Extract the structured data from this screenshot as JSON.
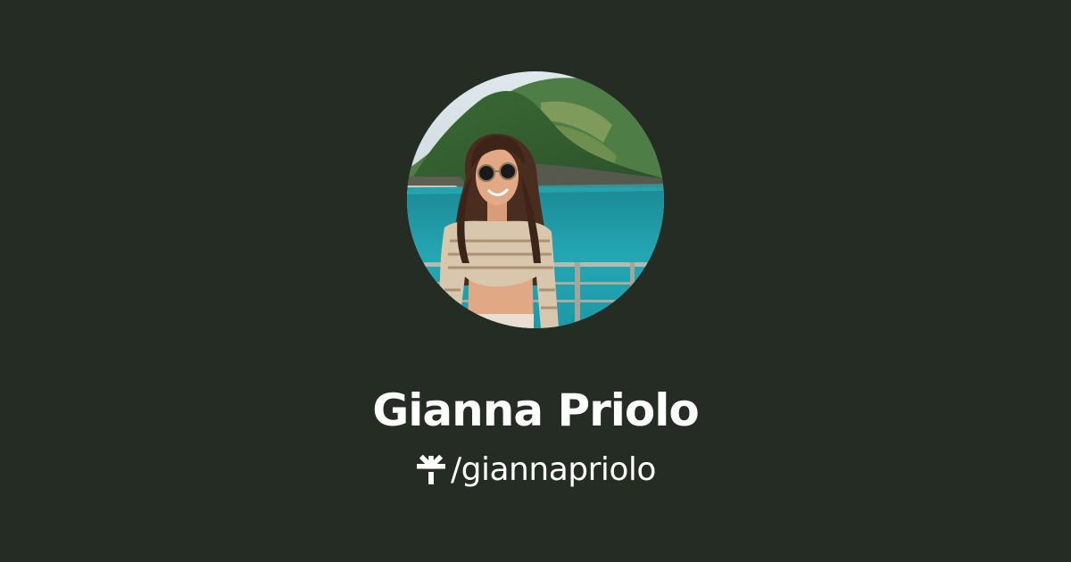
{
  "profile": {
    "name": "Gianna Priolo",
    "handle": "/giannapriolo",
    "avatar_icon": "profile-photo",
    "logo_icon": "linktree-asterisk-icon"
  },
  "colors": {
    "background": "#252c23",
    "text": "#ffffff"
  }
}
